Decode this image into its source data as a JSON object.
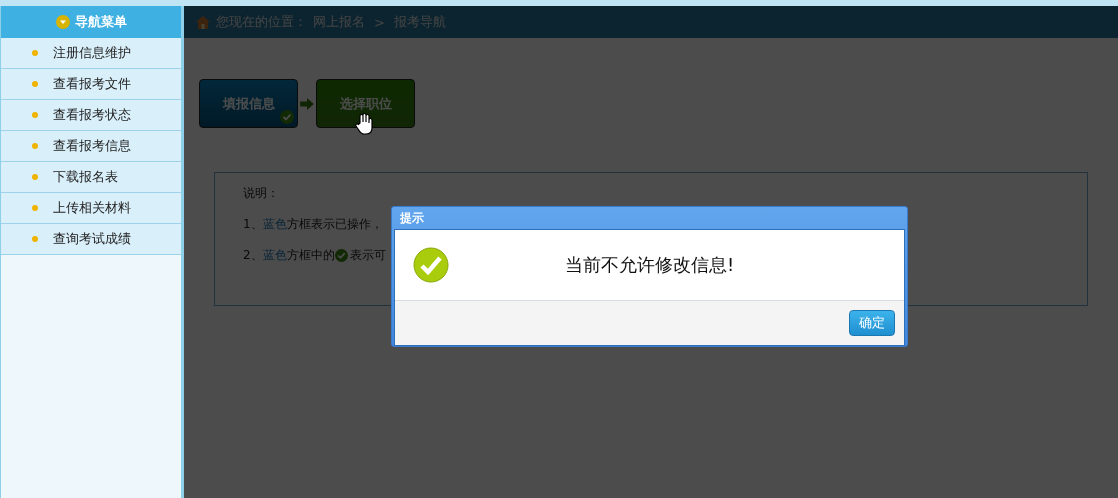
{
  "sidebar": {
    "title": "导航菜单",
    "items": [
      {
        "label": "注册信息维护"
      },
      {
        "label": "查看报考文件"
      },
      {
        "label": "查看报考状态"
      },
      {
        "label": "查看报考信息"
      },
      {
        "label": "下载报名表"
      },
      {
        "label": "上传相关材料"
      },
      {
        "label": "查询考试成绩"
      }
    ]
  },
  "breadcrumb": {
    "prefix": "您现在的位置：",
    "items": [
      "网上报名",
      "报考导航"
    ],
    "separator": ">"
  },
  "steps": [
    {
      "label": "填报信息",
      "completed": true
    },
    {
      "label": "选择职位",
      "completed": false
    }
  ],
  "notes": {
    "title": "说明：",
    "lines": [
      [
        {
          "kind": "text",
          "text": "1、"
        },
        {
          "kind": "highlight",
          "text": "蓝色"
        },
        {
          "kind": "text",
          "text": "方框表示已操作，"
        }
      ],
      [
        {
          "kind": "text",
          "text": "2、"
        },
        {
          "kind": "highlight",
          "text": "蓝色"
        },
        {
          "kind": "text",
          "text": "方框中的 "
        },
        {
          "kind": "icon"
        },
        {
          "kind": "text",
          "text": "表示可"
        }
      ]
    ]
  },
  "dialog": {
    "title": "提示",
    "message": "当前不允许修改信息!",
    "button": "确定"
  }
}
